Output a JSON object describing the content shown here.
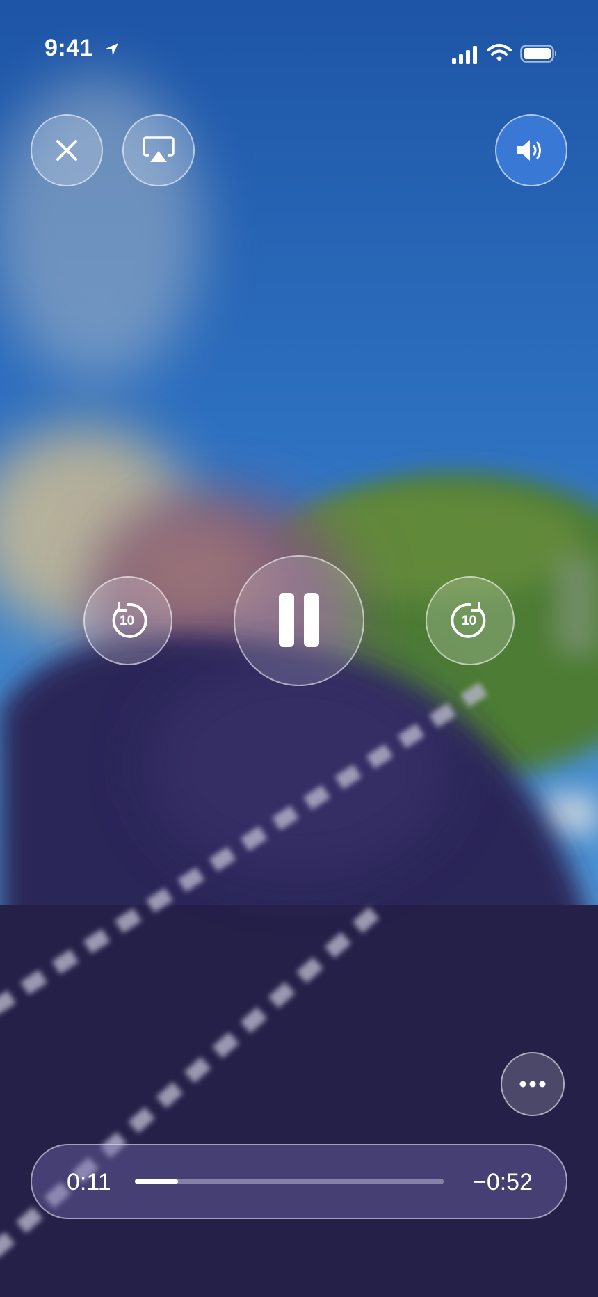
{
  "status_bar": {
    "time": "9:41",
    "icons": [
      "location-arrow-icon",
      "cellular-signal-icon",
      "wifi-icon",
      "battery-icon"
    ]
  },
  "controls": {
    "close_icon": "close-icon",
    "airplay_icon": "airplay-icon",
    "volume_icon": "speaker-icon",
    "skip_back_label": "10",
    "skip_forward_label": "10",
    "play_state": "pause",
    "more_icon": "ellipsis-icon"
  },
  "scrubber": {
    "elapsed": "0:11",
    "remaining": "−0:52",
    "progress": 0.14
  },
  "colors": {
    "accent": "#3a78d6",
    "sky_top": "#1f58a8",
    "sky_mid": "#3b86cf",
    "foreground_purple": "#2a2652",
    "foliage_green": "#4d7a36"
  }
}
